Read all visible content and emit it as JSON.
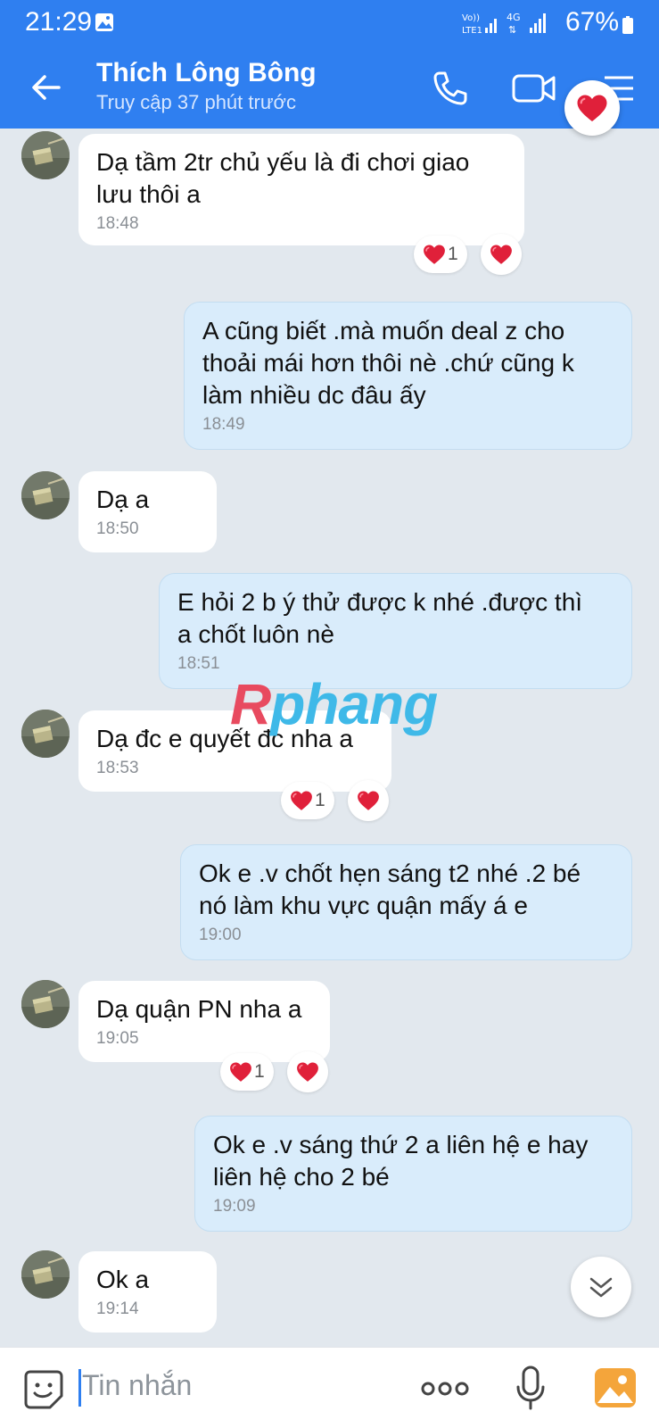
{
  "status_bar": {
    "time": "21:29",
    "network": "VoLTE1 4G",
    "battery": "67%"
  },
  "header": {
    "contact_name": "Thích Lông Bông",
    "last_seen": "Truy cập 37 phút trước"
  },
  "messages": [
    {
      "sender": "contact",
      "text": "Dạ tầm 2tr chủ yếu là đi chơi giao\nlưu thôi a",
      "time": "18:48",
      "reaction_count": "1"
    },
    {
      "sender": "me",
      "text": "A cũng biết .mà muốn deal z cho\nthoải mái hơn thôi nè .chứ cũng k\nlàm nhiều dc đâu ấy",
      "time": "18:49"
    },
    {
      "sender": "contact",
      "text": "Dạ a",
      "time": "18:50"
    },
    {
      "sender": "me",
      "text": "E hỏi 2 b ý thử được k nhé .được thì\na chốt luôn nè",
      "time": "18:51"
    },
    {
      "sender": "contact",
      "text": "Dạ đc e quyết đc nha a",
      "time": "18:53",
      "reaction_count": "1"
    },
    {
      "sender": "me",
      "text": "Ok e .v chốt hẹn sáng t2 nhé .2 bé\nnó làm khu vực quận mấy á e",
      "time": "19:00"
    },
    {
      "sender": "contact",
      "text": "Dạ quận PN nha a",
      "time": "19:05",
      "reaction_count": "1"
    },
    {
      "sender": "me",
      "text": "Ok e .v sáng thứ 2 a liên hệ e hay\nliên hệ cho 2 bé",
      "time": "19:09"
    },
    {
      "sender": "contact",
      "text": "Ok a",
      "time": "19:14"
    }
  ],
  "watermark": {
    "first": "R",
    "rest": "phang"
  },
  "input": {
    "placeholder": "Tin nhắn"
  },
  "icons": {
    "back": "arrow-left-icon",
    "call": "phone-icon",
    "video": "video-camera-icon",
    "menu": "menu-icon",
    "reaction": "heart-icon",
    "sticker": "smiley-sticker-icon",
    "more": "more-dots-icon",
    "mic": "microphone-icon",
    "image": "image-icon",
    "scroll": "chevron-down-double-icon"
  },
  "colors": {
    "header": "#2f7ff0",
    "incoming_bubble": "#ffffff",
    "outgoing_bubble": "#d9ecfb",
    "heart": "#e0203a",
    "background": "#e2e8ee"
  }
}
